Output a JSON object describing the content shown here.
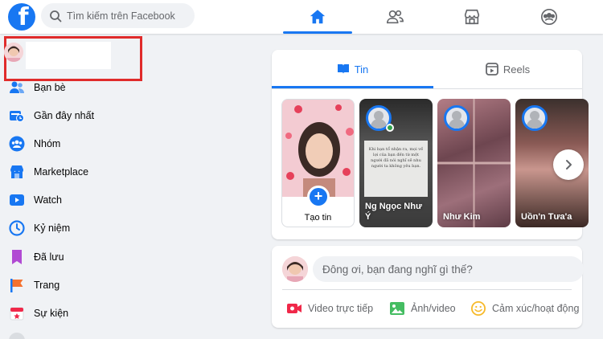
{
  "header": {
    "logo_letter": "f",
    "search": {
      "placeholder": "Tìm kiếm trên Facebook"
    },
    "nav_tabs": [
      {
        "icon": "home-icon",
        "active": true
      },
      {
        "icon": "friends-icon",
        "active": false
      },
      {
        "icon": "marketplace-icon",
        "active": false
      },
      {
        "icon": "groups-icon",
        "active": false
      }
    ],
    "accent_color": "#1877f2"
  },
  "sidebar": {
    "profile": {
      "highlight_color": "#e02b2b"
    },
    "items": [
      {
        "label": "Bạn bè",
        "icon": "friends-icon"
      },
      {
        "label": "Gần đây nhất",
        "icon": "recent-icon"
      },
      {
        "label": "Nhóm",
        "icon": "groups-icon"
      },
      {
        "label": "Marketplace",
        "icon": "marketplace-icon"
      },
      {
        "label": "Watch",
        "icon": "watch-icon"
      },
      {
        "label": "Kỷ niệm",
        "icon": "memories-icon"
      },
      {
        "label": "Đã lưu",
        "icon": "saved-icon"
      },
      {
        "label": "Trang",
        "icon": "pages-icon"
      },
      {
        "label": "Sự kiện",
        "icon": "events-icon"
      }
    ]
  },
  "stories": {
    "tabs": [
      {
        "label": "Tin",
        "icon": "book-icon",
        "active": true
      },
      {
        "label": "Reels",
        "icon": "reels-icon",
        "active": false
      }
    ],
    "create_label": "Tạo tin",
    "items": [
      {
        "name": "Ng Ngọc Như Ý"
      },
      {
        "name": "Như Kim"
      },
      {
        "name": "Uồn'n Tưa'a"
      }
    ],
    "story1_text": "Khi bạn tổ nhận ra, mọi về lợi của bạn đến từ một người đã nói nghĩ sẽ nhu người ta không yêu bạn."
  },
  "composer": {
    "placeholder": "Đông ơi, bạn đang nghĩ gì thế?",
    "actions": [
      {
        "label": "Video trực tiếp",
        "icon": "live-video-icon",
        "color": "#f02849"
      },
      {
        "label": "Ảnh/video",
        "icon": "photo-icon",
        "color": "#45bd62"
      },
      {
        "label": "Cảm xúc/hoạt động",
        "icon": "feeling-icon",
        "color": "#f7b928"
      }
    ]
  }
}
